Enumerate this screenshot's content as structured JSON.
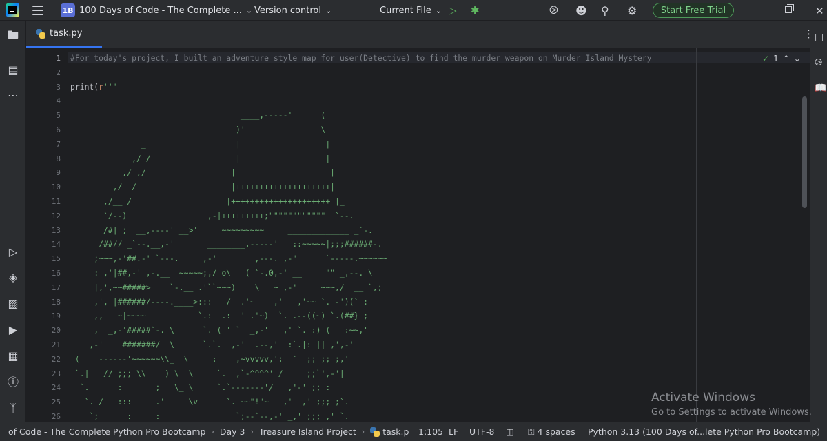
{
  "titlebar": {
    "project_badge": "1B",
    "project_name": "100 Days of Code - The Complete ...",
    "vcs_label": "Version control",
    "run_config": "Current File",
    "trial_button": "Start Free Trial"
  },
  "tabs": [
    {
      "label": "task.py",
      "active": true
    }
  ],
  "inspection": {
    "count": "1"
  },
  "editor": {
    "lines": [
      {
        "num": "1",
        "segments": [
          {
            "t": "#For today's project, I built an adventure style map for user(Detective) to find the murder weapon on Murder Island Mystery",
            "c": "c-comment"
          }
        ]
      },
      {
        "num": "2",
        "segments": []
      },
      {
        "num": "3",
        "segments": [
          {
            "t": "print",
            "c": "c-fn"
          },
          {
            "t": "(",
            "c": "c-paren"
          },
          {
            "t": "r",
            "c": "c-prefix"
          },
          {
            "t": "'''",
            "c": "c-str"
          }
        ]
      },
      {
        "num": "4",
        "segments": [
          {
            "t": "                                             ______",
            "c": "c-str"
          }
        ]
      },
      {
        "num": "5",
        "segments": [
          {
            "t": "                                    ____,-----'      (",
            "c": "c-str"
          }
        ]
      },
      {
        "num": "6",
        "segments": [
          {
            "t": "                                   )'                \\",
            "c": "c-str"
          }
        ]
      },
      {
        "num": "7",
        "segments": [
          {
            "t": "               _                   |                  |",
            "c": "c-str"
          }
        ]
      },
      {
        "num": "8",
        "segments": [
          {
            "t": "             ,/ /                  |                  |",
            "c": "c-str"
          }
        ]
      },
      {
        "num": "9",
        "segments": [
          {
            "t": "           ,/ ,/                  |                    |",
            "c": "c-str"
          }
        ]
      },
      {
        "num": "10",
        "segments": [
          {
            "t": "         ,/  /                    |++++++++++++++++++++|",
            "c": "c-str"
          }
        ]
      },
      {
        "num": "11",
        "segments": [
          {
            "t": "       ,/__ /                    |+++++++++++++++++++++ |_",
            "c": "c-str"
          }
        ]
      },
      {
        "num": "12",
        "segments": [
          {
            "t": "       `/--)          ___  __,-|+++++++++;\"\"\"\"\"\"\"\"\"\"\"\"  `--._",
            "c": "c-str"
          }
        ]
      },
      {
        "num": "13",
        "segments": [
          {
            "t": "       /#| ;  __,----' __>'     ~~~~~~~~~     _____________ _`-.",
            "c": "c-str"
          }
        ]
      },
      {
        "num": "14",
        "segments": [
          {
            "t": "      /##// _`--.__,-'       ________,-----'   ::~~~~~|;;;######-.",
            "c": "c-str"
          }
        ]
      },
      {
        "num": "15",
        "segments": [
          {
            "t": "     ;~~~,-'##.-' `---._____,-'__      ,---._,-\"      `-----.~~~~~~",
            "c": "c-str"
          }
        ]
      },
      {
        "num": "16",
        "segments": [
          {
            "t": "     : ,'|##,-' ,-.__  ~~~~~;,/ o\\   ( `-.0,-' __     \"\" _,--. \\",
            "c": "c-str"
          }
        ]
      },
      {
        "num": "17",
        "segments": [
          {
            "t": "     |,',~~#####>    `-.__ .'``~~~)    \\   ~ ,-'     ~~~,/  __ `,;",
            "c": "c-str"
          }
        ]
      },
      {
        "num": "18",
        "segments": [
          {
            "t": "     ,', |######/----.____>:::   /  .'~    ,'   ,'~~ `. -')(` :",
            "c": "c-str"
          }
        ]
      },
      {
        "num": "19",
        "segments": [
          {
            "t": "     ,,   ~|~~~~  ___      `.:  .:  ' .'~)  `. .--((~) `.(##} ;",
            "c": "c-str"
          }
        ]
      },
      {
        "num": "20",
        "segments": [
          {
            "t": "     ,  _,-'#####`-. \\      `. ( ' `  _,-'   ,' `. :) (   :~~,'",
            "c": "c-str"
          }
        ]
      },
      {
        "num": "21",
        "segments": [
          {
            "t": "  __,-'    #######/  \\_     `.`.__,-'__.--,'  :`.|: || ,',-'",
            "c": "c-str"
          }
        ]
      },
      {
        "num": "22",
        "segments": [
          {
            "t": " (    ------'~~~~~~\\\\_  \\     :    ,~vvvvv,';  `  ;; ;; ;,'",
            "c": "c-str"
          }
        ]
      },
      {
        "num": "23",
        "segments": [
          {
            "t": " `.|   // ;;; \\\\    ) \\_ \\_    `.  ,`-^^^^' /     ;;`',-'|",
            "c": "c-str"
          }
        ]
      },
      {
        "num": "24",
        "segments": [
          {
            "t": "  `.      :       ;   \\_ \\     `.`-------'/   ,'-' ;; :",
            "c": "c-str"
          }
        ]
      },
      {
        "num": "25",
        "segments": [
          {
            "t": "   `. /   :::     .'     \\v      `. ~~\"!\"~   ,'  ,' ;;; ;`.",
            "c": "c-str"
          }
        ]
      },
      {
        "num": "26",
        "segments": [
          {
            "t": "    `;      :     :                `;--`--,-' _,' ;;; ,' `.",
            "c": "c-str"
          }
        ]
      }
    ]
  },
  "watermark": {
    "title": "Activate Windows",
    "subtitle": "Go to Settings to activate Windows."
  },
  "statusbar": {
    "breadcrumb": [
      "of Code - The Complete Python Pro Bootcamp",
      "Day 3",
      "Treasure Island Project",
      "task.p"
    ],
    "position": "1:105",
    "line_sep": "LF",
    "encoding": "UTF-8",
    "indent": "4 spaces",
    "interpreter": "Python 3.13 (100 Days of...lete Python Pro Bootcamp)"
  }
}
